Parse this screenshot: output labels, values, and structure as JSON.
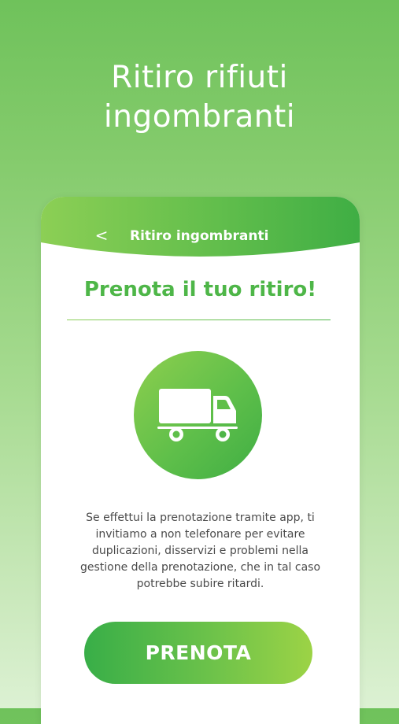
{
  "promo": {
    "title_line1": "Ritiro rifiuti",
    "title_line2": "ingombranti"
  },
  "app_header": {
    "back_label": "<",
    "title": "Ritiro ingombranti"
  },
  "main": {
    "heading": "Prenota il tuo ritiro!",
    "icon": "truck-icon",
    "info_text": "Se effettui la prenotazione tramite app, ti invitiamo a non telefonare per evitare duplicazioni, disservizi e problemi nella gestione della prenotazione, che in tal caso potrebbe subire ritardi.",
    "button_label": "PRENOTA"
  },
  "colors": {
    "brand_green": "#4eb648",
    "light_green": "#9cd346",
    "text_gray": "#4a4a4a"
  }
}
